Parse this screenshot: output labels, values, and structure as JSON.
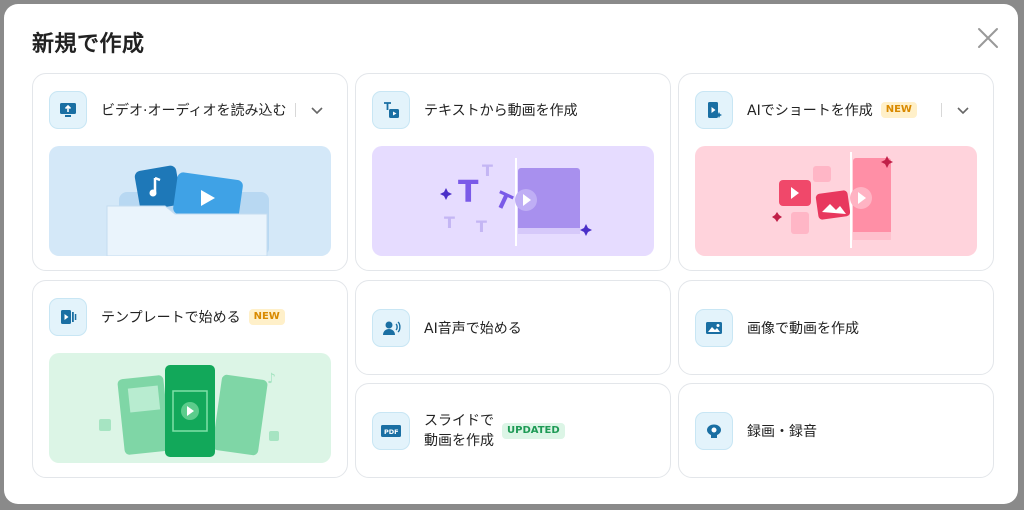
{
  "dialog": {
    "title": "新規で作成",
    "close_icon": "close-icon"
  },
  "cards": {
    "import_av": {
      "label": "ビデオ·オーディオを読み込む",
      "icon": "monitor-upload-icon",
      "has_dropdown": true
    },
    "text_to_video": {
      "label": "テキストから動画を作成",
      "icon": "text-to-video-icon"
    },
    "ai_short": {
      "label": "AIでショートを作成",
      "badge": "NEW",
      "icon": "ai-short-icon",
      "has_dropdown": true
    },
    "template": {
      "label": "テンプレートで始める",
      "badge": "NEW",
      "icon": "template-icon"
    },
    "ai_voice": {
      "label": "AI音声で始める",
      "icon": "ai-voice-icon"
    },
    "image_to_video": {
      "label": "画像で動画を作成",
      "icon": "image-icon"
    },
    "slide": {
      "label_line1": "スライドで",
      "label_line2": "動画を作成",
      "badge": "UPDATED",
      "icon": "pdf-slide-icon"
    },
    "record": {
      "label": "録画・録音",
      "icon": "webcam-icon"
    }
  },
  "colors": {
    "accent": "#1a6fa3",
    "import_bg": "#d4e8f8",
    "text_bg": "#e6dcff",
    "short_bg": "#ffd3dc",
    "template_bg": "#dcf5e6",
    "new_badge": "#d98a00",
    "updated_badge": "#1e9a55"
  }
}
